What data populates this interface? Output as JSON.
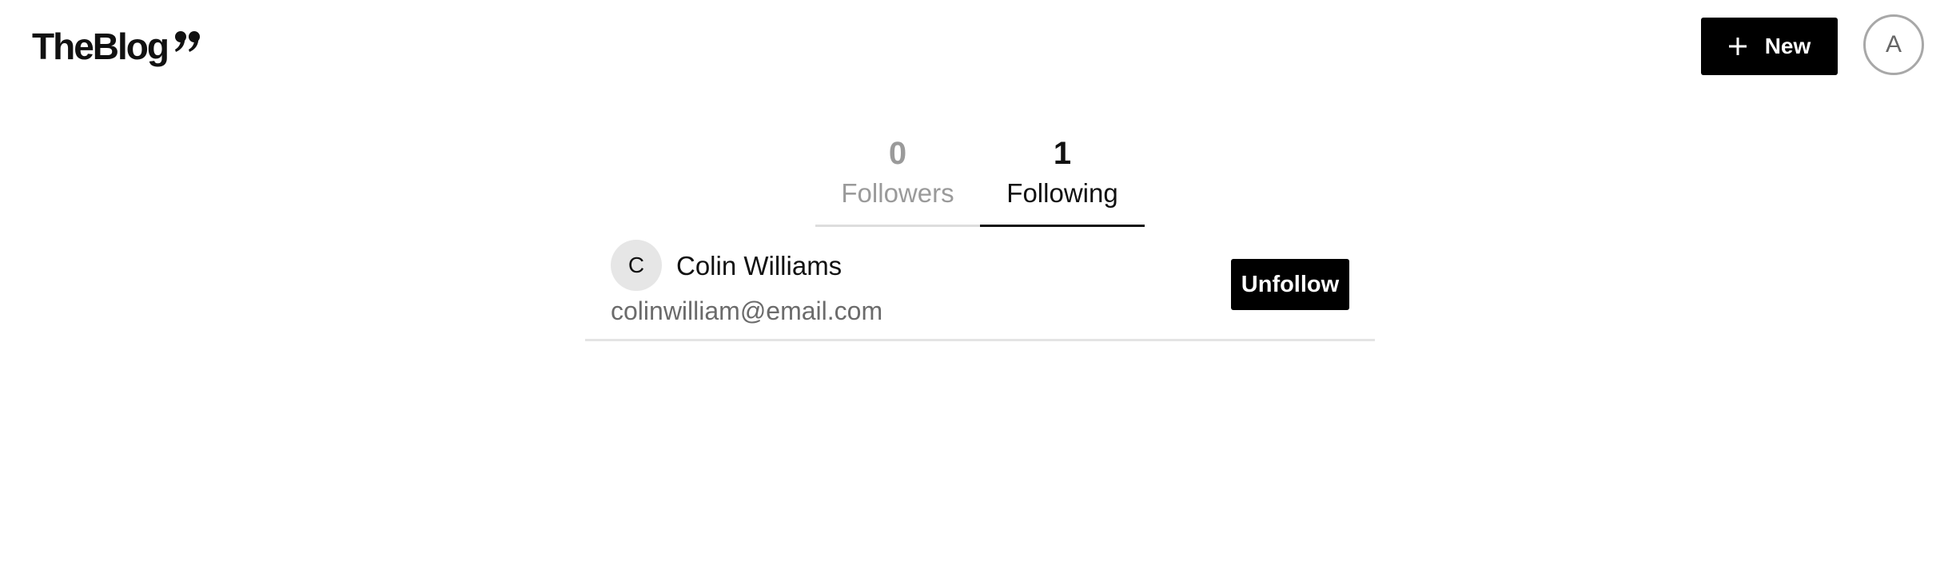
{
  "header": {
    "logo_text": "TheBlog",
    "logo_icon": "quote-icon",
    "new_button": {
      "label": "New",
      "icon": "plus-icon"
    },
    "avatar_initial": "A"
  },
  "tabs": [
    {
      "count": "0",
      "label": "Followers",
      "active": false
    },
    {
      "count": "1",
      "label": "Following",
      "active": true
    }
  ],
  "following_list": [
    {
      "avatar_initial": "C",
      "name": "Colin Williams",
      "email": "colinwilliam@email.com",
      "action_label": "Unfollow"
    }
  ],
  "colors": {
    "accent": "#000000",
    "inactive_text": "#9a9a9a",
    "email_text": "#6b6b6b",
    "avatar_bg": "#e6e6e6",
    "divider": "#e4e4e4"
  }
}
